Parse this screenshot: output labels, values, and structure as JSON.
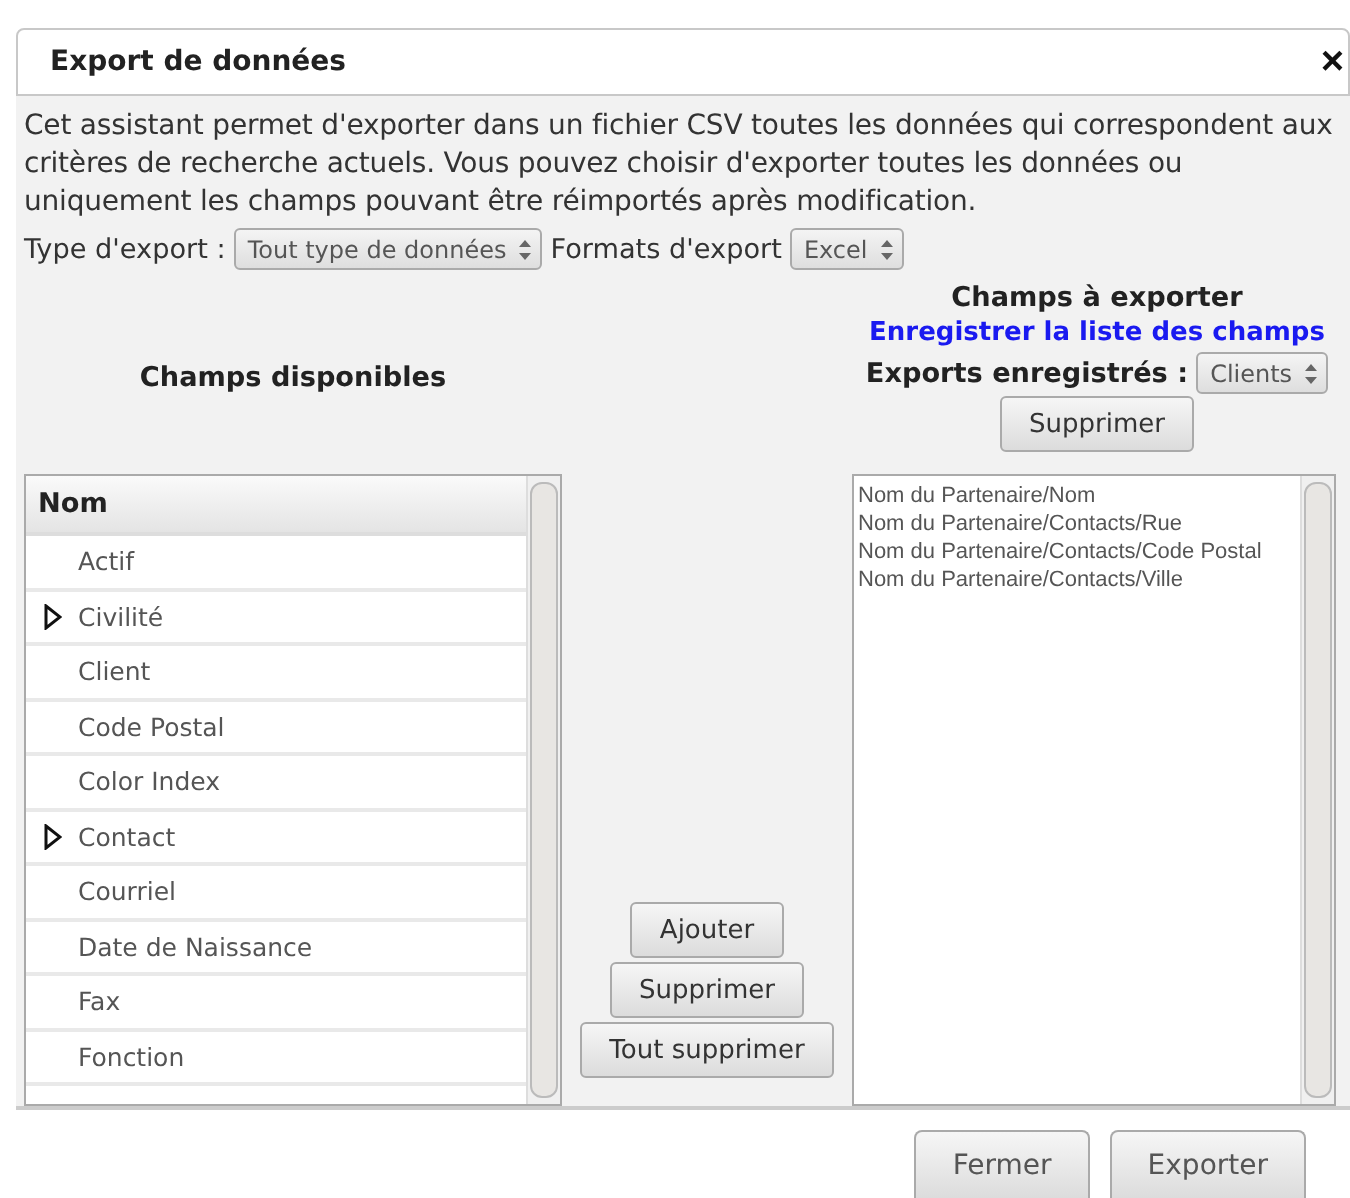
{
  "dialog": {
    "title": "Export de données",
    "close": "×"
  },
  "description": "Cet assistant permet d'exporter dans un fichier CSV toutes les données qui correspondent aux critères de recherche actuels. Vous pouvez choisir d'exporter toutes les données ou uniquement les champs pouvant être réimportés après modification.",
  "export_type": {
    "label": "Type d'export :",
    "value": "Tout type de données"
  },
  "export_format": {
    "label": "Formats d'export",
    "value": "Excel"
  },
  "available": {
    "heading": "Champs disponibles",
    "column": "Nom",
    "rows": [
      {
        "label": "Actif",
        "expandable": false
      },
      {
        "label": "Civilité",
        "expandable": true
      },
      {
        "label": "Client",
        "expandable": false
      },
      {
        "label": "Code Postal",
        "expandable": false
      },
      {
        "label": "Color Index",
        "expandable": false
      },
      {
        "label": "Contact",
        "expandable": true
      },
      {
        "label": "Courriel",
        "expandable": false
      },
      {
        "label": "Date de Naissance",
        "expandable": false
      },
      {
        "label": "Fax",
        "expandable": false
      },
      {
        "label": "Fonction",
        "expandable": false
      }
    ]
  },
  "middle_buttons": [
    "Ajouter",
    "Supprimer",
    "Tout supprimer"
  ],
  "selected": {
    "heading": "Champs à exporter",
    "save_link": "Enregistrer la liste des champs",
    "saved_label": "Exports enregistrés :",
    "saved_value": "Clients",
    "delete_button": "Supprimer",
    "items": [
      "Nom du Partenaire/Nom",
      "Nom du Partenaire/Contacts/Rue",
      "Nom du Partenaire/Contacts/Code Postal",
      "Nom du Partenaire/Contacts/Ville"
    ]
  },
  "footer_buttons": [
    "Fermer",
    "Exporter"
  ]
}
